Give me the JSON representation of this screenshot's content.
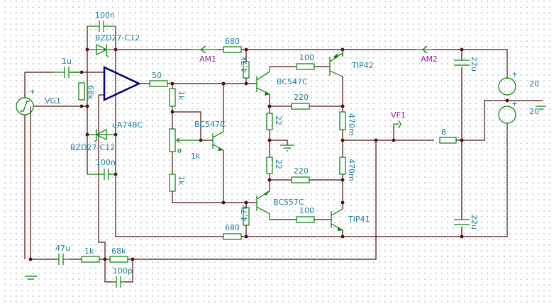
{
  "labels": {
    "c_100n_top": "100n",
    "zener_top": "BZD27-C12",
    "zener_bottom": "BZD27-C12",
    "c_100n_bottom": "100n",
    "c_1u": "1u",
    "r_68k_input": "68k",
    "source_vg1": "VG1",
    "opamp": "uA748C",
    "am1": "AM1",
    "am2": "AM2",
    "r_680_top": "680",
    "r_680_bottom": "680",
    "r_50": "50",
    "r_1k_a": "1k",
    "pot_1k": "1k",
    "r_1k_b": "1k",
    "q_vbe": "BC547C",
    "q_driver_top": "BC547C",
    "q_driver_bottom": "BC557C",
    "r_4k7_top": "4,7k",
    "r_4k7_bottom": "4,7k",
    "r_100_top": "100",
    "r_100_bottom": "100",
    "r_220_top": "220",
    "r_220_bottom": "220",
    "r_22_top": "22",
    "r_22_bottom": "22",
    "r_470m_top": "470m",
    "r_470m_bottom": "470m",
    "q_out_top": "TIP42",
    "q_out_bottom": "TIP41",
    "vf1": "VF1",
    "r_load": "8",
    "c_22u_top": "22u",
    "c_22u_bottom": "22u",
    "supply_top": "20",
    "supply_bottom": "20",
    "c_47u": "47u",
    "r_1k_fb": "1k",
    "r_68k_fb": "68k",
    "c_100p": "100p",
    "plus_sign": "+"
  },
  "colors": {
    "wire": "#4a0d0d",
    "component": "#008000",
    "opamp": "#000080",
    "label": "#1a7fa0",
    "meter_label": "#a020a0"
  }
}
